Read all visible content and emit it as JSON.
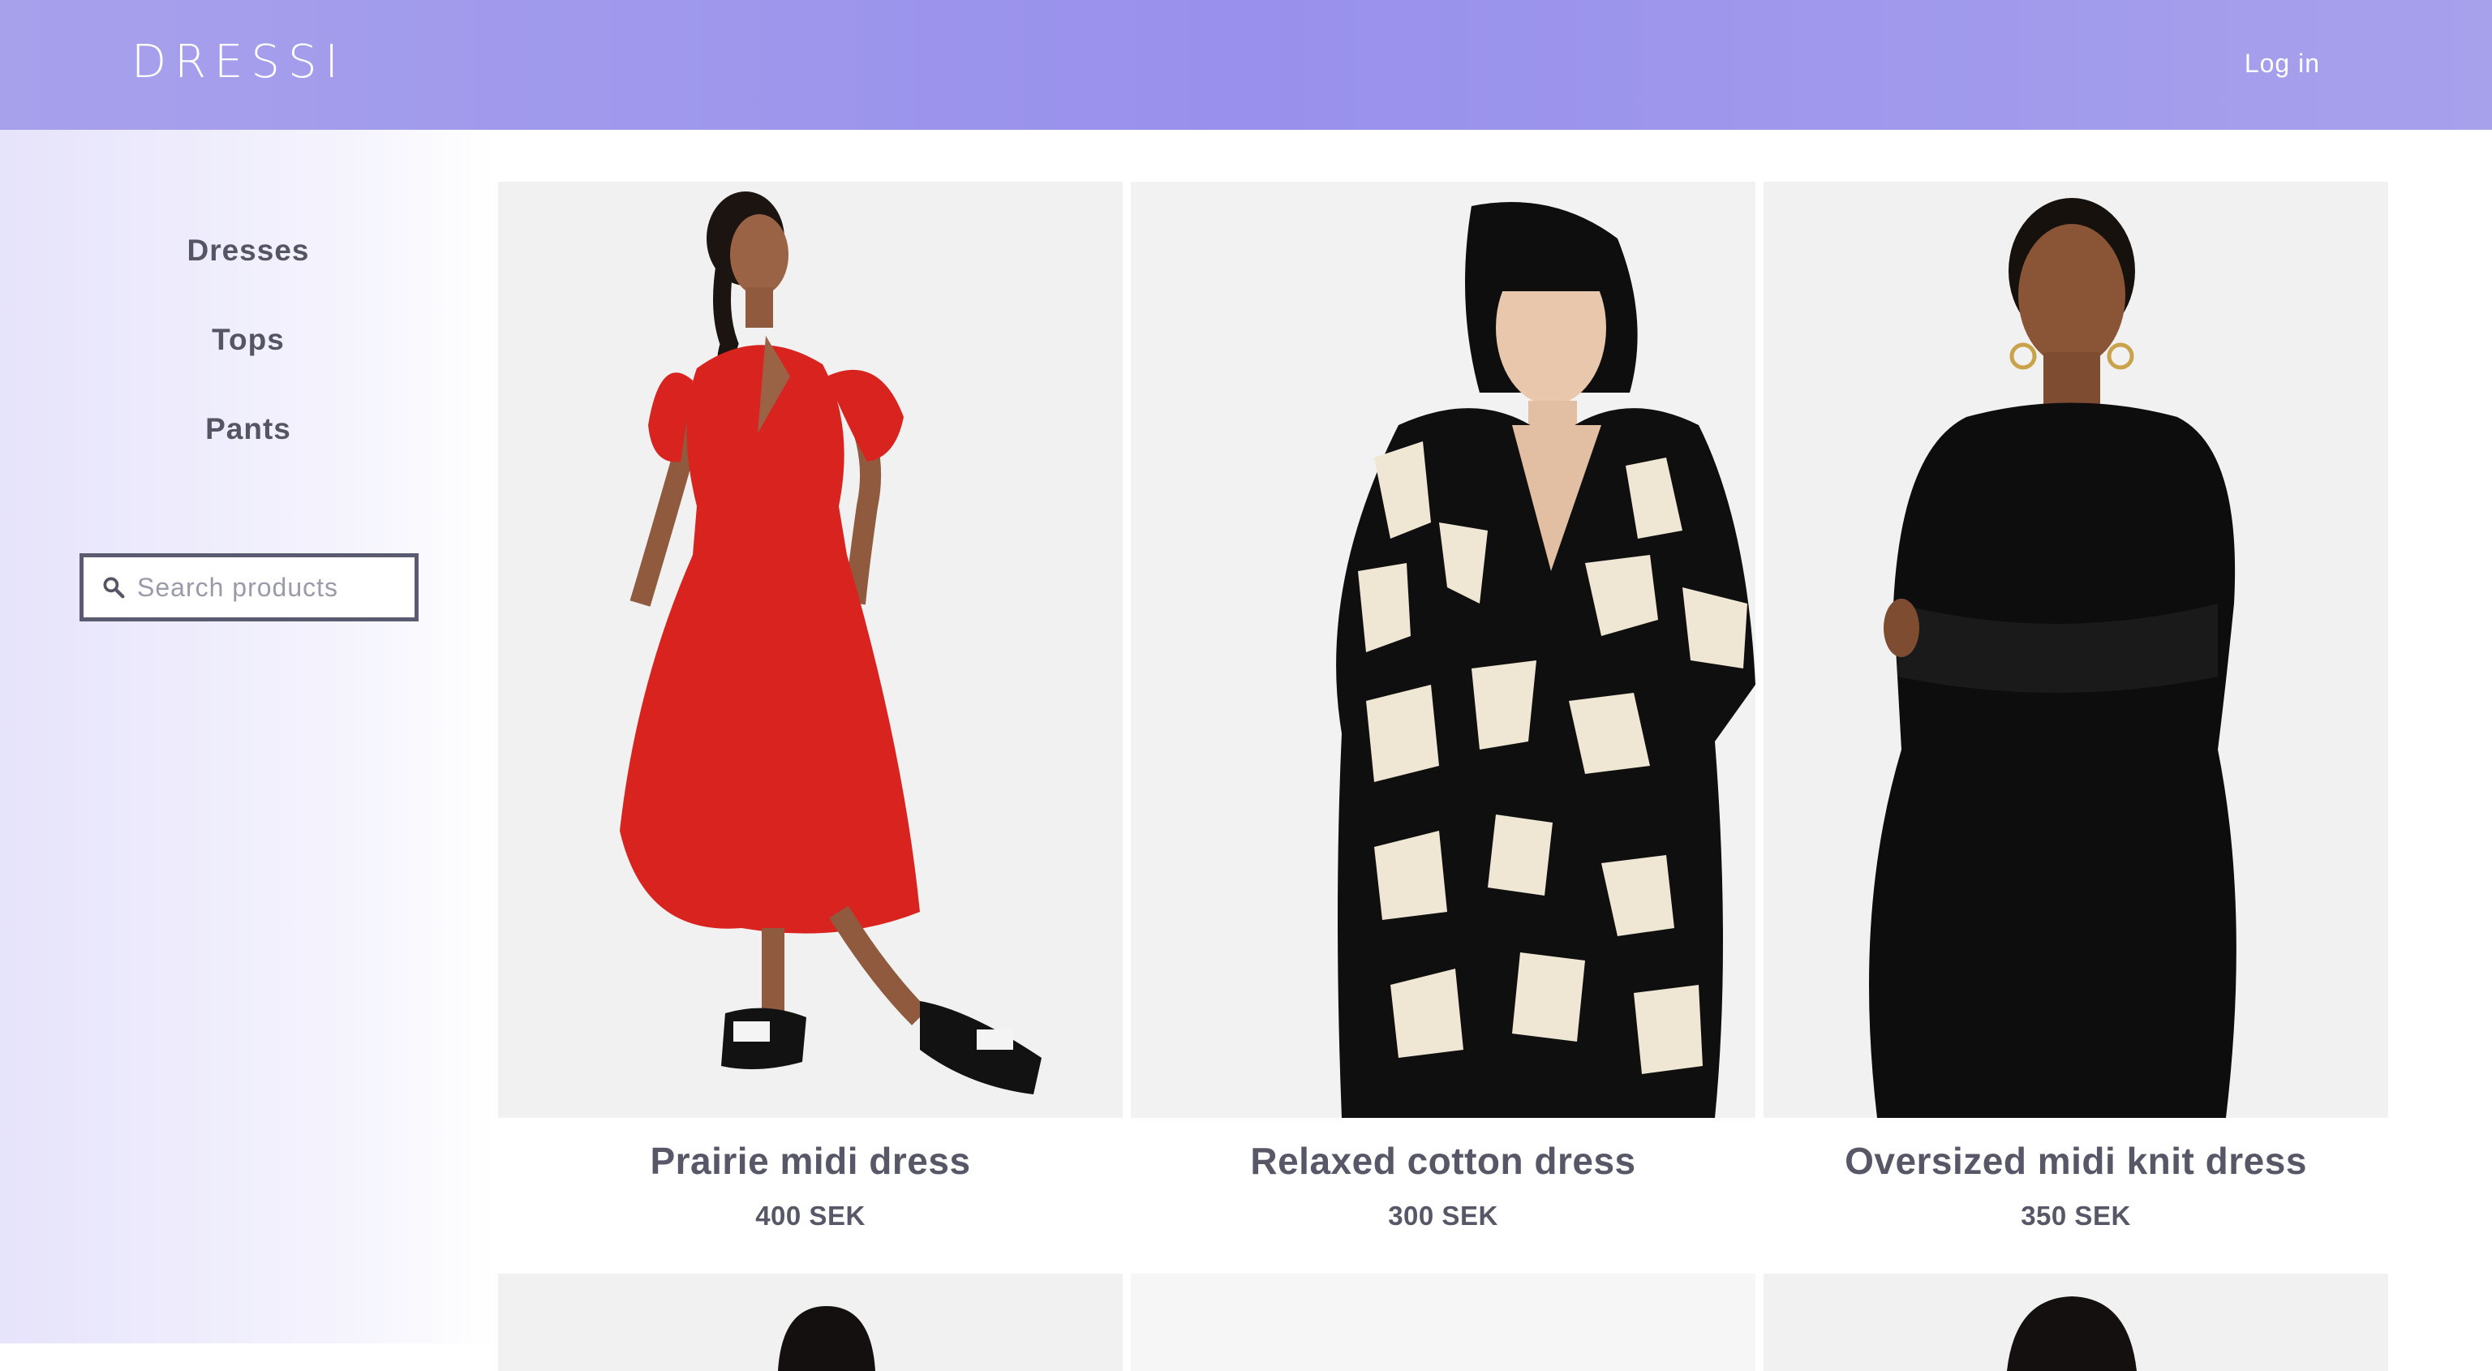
{
  "header": {
    "logo": "DRESSI",
    "login_label": "Log in"
  },
  "sidebar": {
    "nav": [
      {
        "label": "Dresses"
      },
      {
        "label": "Tops"
      },
      {
        "label": "Pants"
      }
    ],
    "search": {
      "placeholder": "Search products",
      "value": ""
    }
  },
  "products": [
    {
      "name": "Prairie midi dress",
      "price": "400 SEK"
    },
    {
      "name": "Relaxed cotton dress",
      "price": "300 SEK"
    },
    {
      "name": "Oversized midi knit dress",
      "price": "350 SEK"
    }
  ],
  "icons": {
    "search": "search-icon"
  },
  "colors": {
    "header": "#9890ec",
    "text": "#575768",
    "sidebar": "#e6e3fb"
  }
}
